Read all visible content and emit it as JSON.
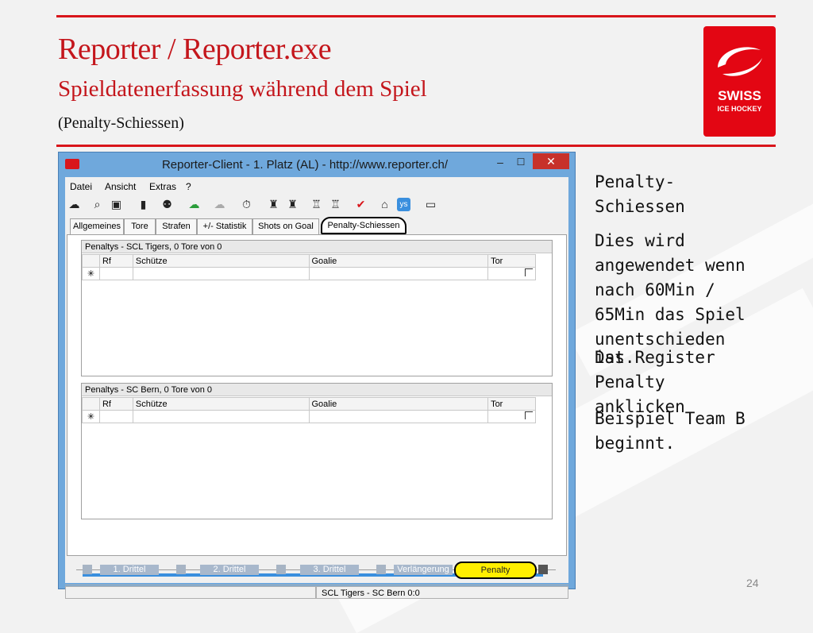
{
  "slide": {
    "title": "Reporter / Reporter.exe",
    "subtitle": "Spieldatenerfassung während dem Spiel",
    "subtitle2": "(Penalty-Schiessen)",
    "page_number": "24",
    "logo": {
      "line1": "SWISS",
      "line2": "ICE HOCKEY",
      "color": "#e30613"
    }
  },
  "window": {
    "title": "Reporter-Client  -  1. Platz (AL)  -  http://www.reporter.ch/",
    "minimize": "–",
    "maximize": "☐",
    "close": "✕"
  },
  "menu": [
    "Datei",
    "Ansicht",
    "Extras",
    "?"
  ],
  "toolbar_icons": [
    "cloud-download-icon",
    "search-icon",
    "save-icon",
    "clipboard-icon",
    "players-icon",
    "cloud-upload-icon",
    "cloud-disabled-icon",
    "stopwatch-icon",
    "team-icon",
    "team-icon",
    "team-swap-icon",
    "team-swap-icon",
    "checkmark-icon",
    "home-icon",
    "ys-icon",
    "tv-icon"
  ],
  "tabs": [
    "Allgemeines",
    "Tore",
    "Strafen",
    "+/- Statistik",
    "Shots on Goal",
    "Penalty-Schiessen"
  ],
  "sections": [
    {
      "caption": "Penaltys - SCL Tigers, 0 Tore von 0",
      "columns": [
        "Rf",
        "Schütze",
        "Goalie",
        "Tor"
      ],
      "row_marker": "✳"
    },
    {
      "caption": "Penaltys - SC Bern, 0 Tore von 0",
      "columns": [
        "Rf",
        "Schütze",
        "Goalie",
        "Tor"
      ],
      "row_marker": "✳"
    }
  ],
  "periods": [
    "1. Drittel",
    "2. Drittel",
    "3. Drittel",
    "Verlängerung",
    "Penalty"
  ],
  "status": {
    "score": "SCL Tigers - SC Bern 0:0"
  },
  "notes": {
    "p1": [
      "Penalty-",
      "Schiessen"
    ],
    "p2": [
      "Dies wird",
      "angewendet wenn",
      "nach 60Min /",
      "65Min das Spiel",
      "unentschieden",
      "ist."
    ],
    "p3": [
      "Das Register",
      "Penalty",
      "anklicken"
    ],
    "p4": [
      "Beispiel Team B",
      "beginnt."
    ]
  },
  "colors": {
    "accent": "#c4161c",
    "penalty_highlight": "#ffef00",
    "titlebar": "#6fa8dc"
  }
}
